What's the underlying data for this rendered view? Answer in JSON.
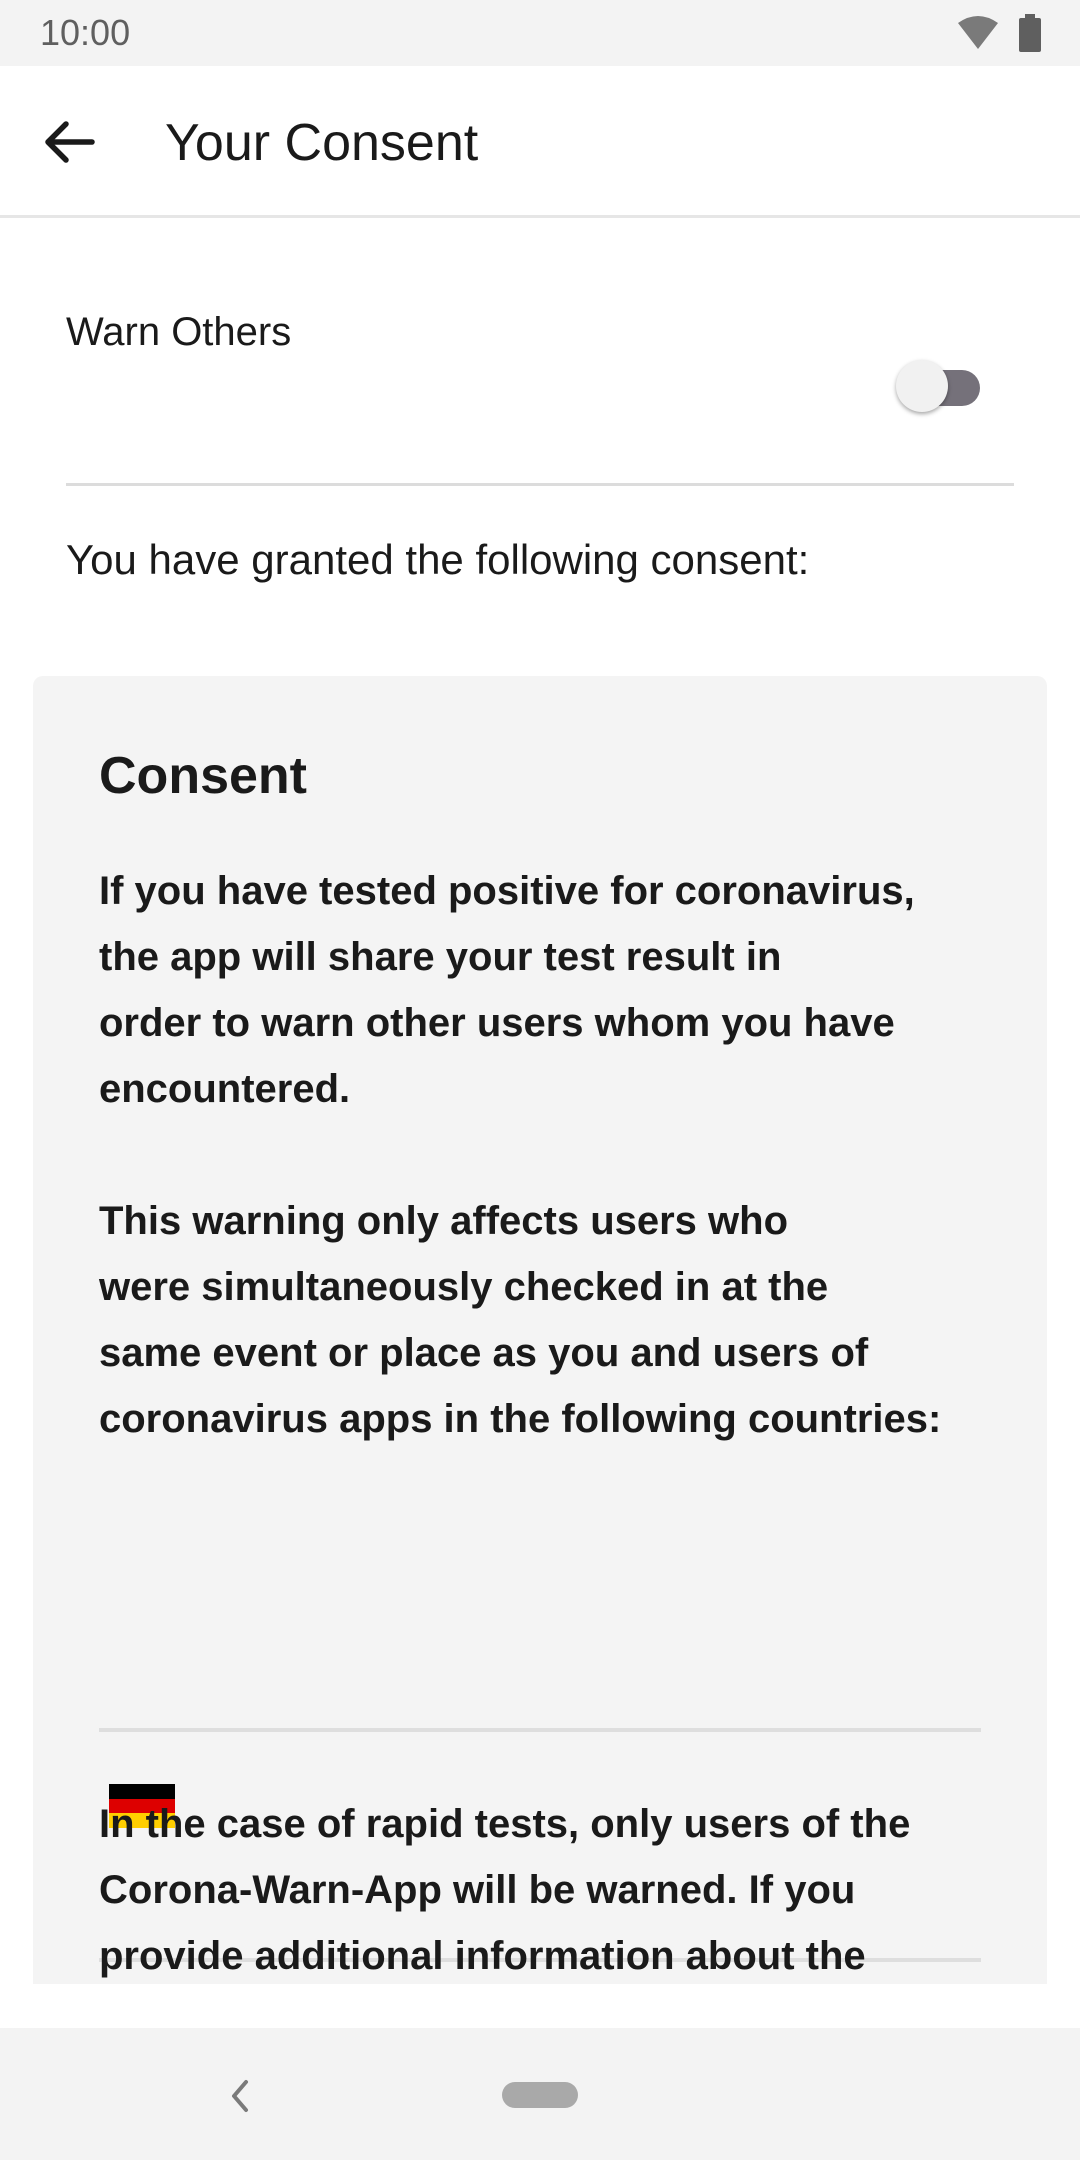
{
  "status_bar": {
    "time": "10:00",
    "icons": [
      "wifi-icon",
      "battery-icon"
    ]
  },
  "app_bar": {
    "title": "Your Consent",
    "back_icon": "arrow-left-icon"
  },
  "warn_others": {
    "label": "Warn Others",
    "enabled": false
  },
  "granted_text": "You have granted the following consent:",
  "consent_card": {
    "title": "Consent",
    "paragraph_1": "If you have tested positive for coronavirus,\nthe app will share your test result in\norder to warn other users whom you have\nencountered.",
    "paragraph_2": "This warning only affects users who\nwere simultaneously checked in at the\nsame event or place as you and users of\ncoronavirus apps in the following countries:",
    "countries": [
      "Germany"
    ],
    "paragraph_3": "In the case of rapid tests, only users of the\nCorona-Warn-App will be warned. If you\nprovide additional information about the"
  },
  "nav_bar": {
    "back_icon": "chevron-left-icon",
    "home_icon": "home-pill-icon"
  },
  "colors": {
    "status_bar_bg": "#f3f3f3",
    "card_bg": "#f4f4f4",
    "toggle_track": "#75717a",
    "flag_black": "#000000",
    "flag_red": "#dd0000",
    "flag_gold": "#ffce00"
  }
}
